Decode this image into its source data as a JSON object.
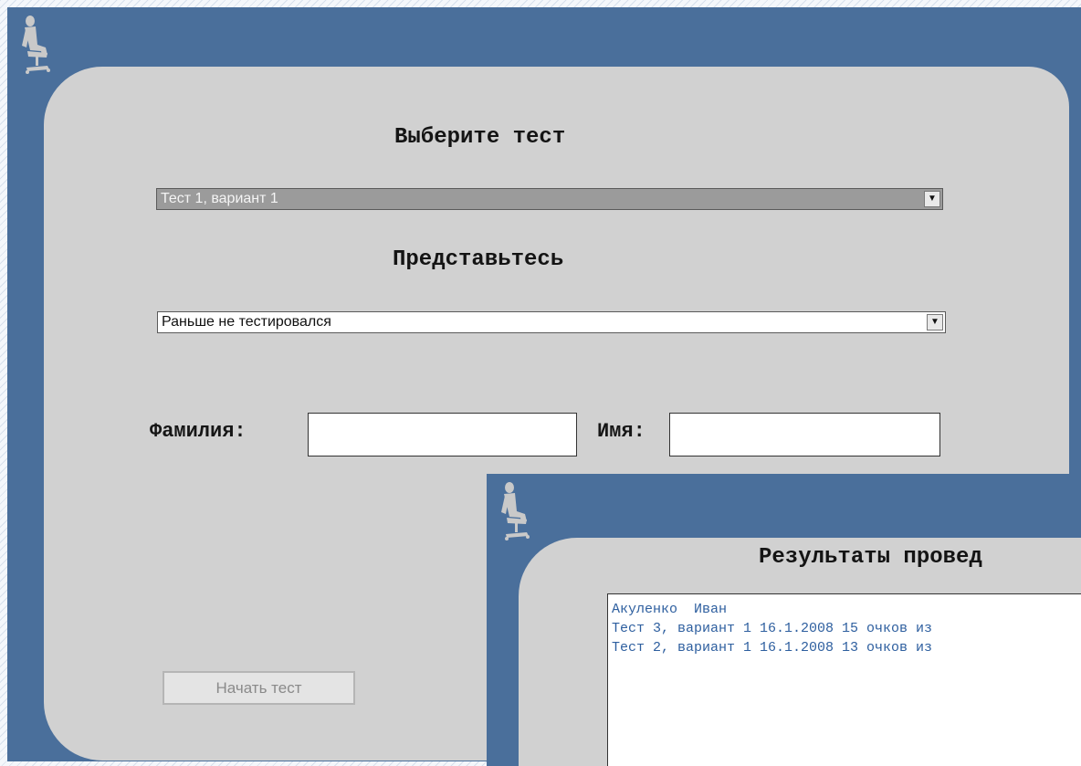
{
  "colors": {
    "window_bg": "#4a6f9b",
    "panel_bg": "#d1d1d1",
    "selected_select_bg": "#9b9b9b",
    "result_text": "#2e5f9f"
  },
  "icons": {
    "window_logo": "person-in-chair-icon"
  },
  "test_window": {
    "heading_choose_test": "Выберите тест",
    "test_select": {
      "selected": "Тест 1, вариант 1"
    },
    "heading_introduce": "Представьтесь",
    "user_select": {
      "selected": "Раньше не тестировался"
    },
    "surname_label": "Фамилия:",
    "surname_value": "",
    "name_label": "Имя:",
    "name_value": "",
    "start_button_label": "Начать тест"
  },
  "results_window": {
    "heading": "Результаты провед",
    "lines": [
      "Акуленко  Иван",
      "Тест 3, вариант 1 16.1.2008 15 очков из",
      "Тест 2, вариант 1 16.1.2008 13 очков из"
    ]
  }
}
